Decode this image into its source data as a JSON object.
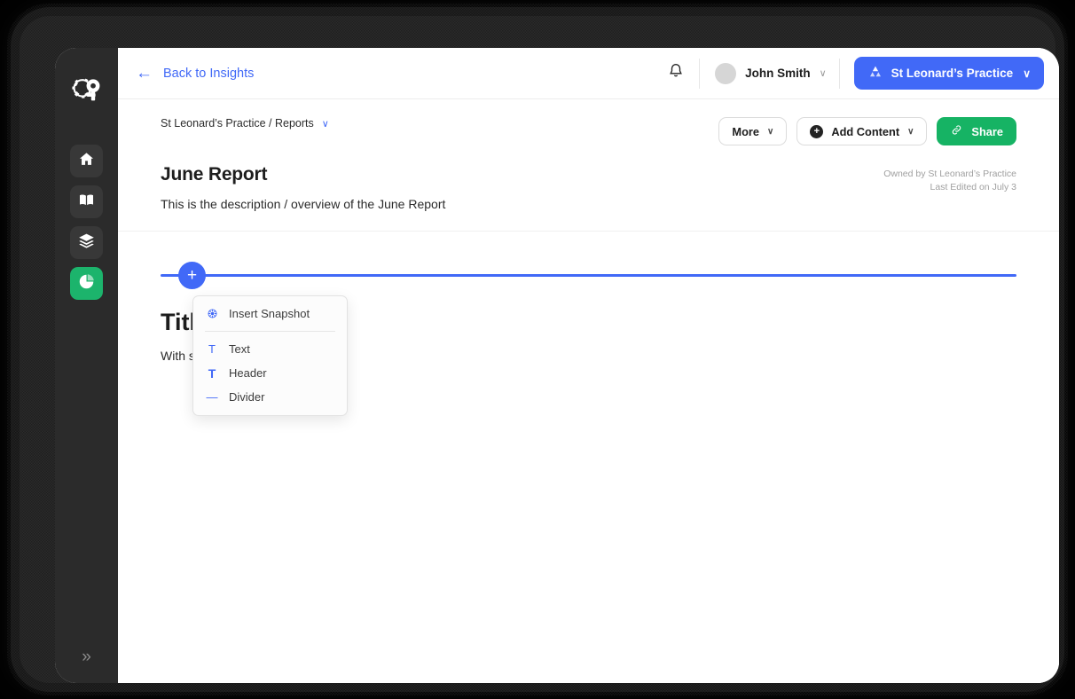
{
  "sidebar": {
    "logo_name": "gp-logo",
    "items": [
      {
        "icon": "home-icon",
        "name": "sidebar-item-home",
        "active": false
      },
      {
        "icon": "book-icon",
        "name": "sidebar-item-library",
        "active": false
      },
      {
        "icon": "layers-icon",
        "name": "sidebar-item-datasets",
        "active": false
      },
      {
        "icon": "pie-chart-icon",
        "name": "sidebar-item-insights",
        "active": true
      }
    ],
    "collapse_glyph": "»"
  },
  "topbar": {
    "back_label": "Back to Insights",
    "back_arrow": "←",
    "bell_icon": "notification-bell-icon",
    "user_name": "John Smith",
    "user_chevron": "∨",
    "practice_label": "St Leonard’s Practice",
    "practice_chevron": "∨",
    "practice_icon": "triangle-logo-icon",
    "accent_blue": "#4169f7"
  },
  "header": {
    "breadcrumb": "St Leonard’s Practice / Reports",
    "breadcrumb_chevron": "∨",
    "title": "June Report",
    "description": "This is the description / overview of the June Report",
    "owned_by": "Owned by St Leonard’s Practice",
    "last_edited": "Last Edited on July 3",
    "actions": {
      "more_label": "More",
      "more_chevron": "∨",
      "add_content_label": "Add Content",
      "add_content_plus": "+",
      "add_content_chevron": "∨",
      "share_label": "Share",
      "share_icon": "link-icon",
      "share_color": "#16b364"
    }
  },
  "canvas": {
    "insert_plus": "+",
    "insert_line_color": "#4169f7",
    "doc_title": "Title",
    "doc_text": "With some text",
    "menu": {
      "items": [
        {
          "label": "Insert Snapshot",
          "icon": "aperture-icon",
          "glyph": ""
        },
        {
          "label": "Text",
          "icon": "text-icon",
          "glyph": "T"
        },
        {
          "label": "Header",
          "icon": "header-icon",
          "glyph": "T"
        },
        {
          "label": "Divider",
          "icon": "divider-icon",
          "glyph": "—"
        }
      ]
    }
  }
}
